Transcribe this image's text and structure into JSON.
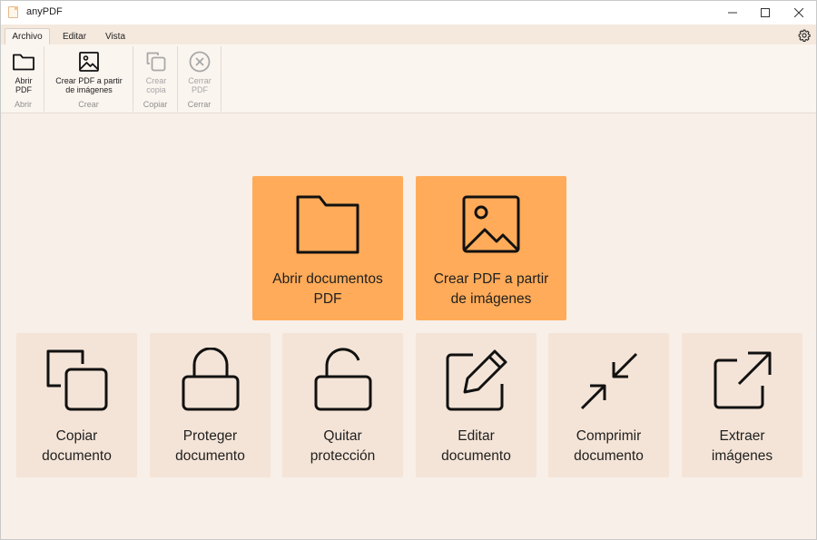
{
  "window": {
    "title": "anyPDF"
  },
  "tabs": [
    {
      "label": "Archivo",
      "active": true
    },
    {
      "label": "Editar",
      "active": false
    },
    {
      "label": "Vista",
      "active": false
    }
  ],
  "ribbon": {
    "groups": [
      {
        "label": "Abrir",
        "buttons": [
          {
            "label_line1": "Abrir",
            "label_line2": "PDF",
            "icon": "folder-icon",
            "enabled": true
          }
        ]
      },
      {
        "label": "Crear",
        "buttons": [
          {
            "label_line1": "Crear PDF a partir",
            "label_line2": "de imágenes",
            "icon": "image-icon",
            "enabled": true
          }
        ]
      },
      {
        "label": "Copiar",
        "buttons": [
          {
            "label_line1": "Crear",
            "label_line2": "copia",
            "icon": "copy-icon",
            "enabled": false
          }
        ]
      },
      {
        "label": "Cerrar",
        "buttons": [
          {
            "label_line1": "Cerrar",
            "label_line2": "PDF",
            "icon": "close-circle-icon",
            "enabled": false
          }
        ]
      }
    ]
  },
  "main": {
    "primary_actions": [
      {
        "line1": "Abrir documentos",
        "line2": "PDF",
        "icon": "folder-icon"
      },
      {
        "line1": "Crear PDF a partir",
        "line2": "de imágenes",
        "icon": "image-icon"
      }
    ],
    "secondary_actions": [
      {
        "line1": "Copiar",
        "line2": "documento",
        "icon": "copy-icon"
      },
      {
        "line1": "Proteger",
        "line2": "documento",
        "icon": "lock-icon"
      },
      {
        "line1": "Quitar",
        "line2": "protección",
        "icon": "unlock-icon"
      },
      {
        "line1": "Editar",
        "line2": "documento",
        "icon": "edit-icon"
      },
      {
        "line1": "Comprimir",
        "line2": "documento",
        "icon": "compress-icon"
      },
      {
        "line1": "Extraer",
        "line2": "imágenes",
        "icon": "external-link-icon"
      }
    ]
  },
  "colors": {
    "background": "#f7efe8",
    "primary_card": "#ffab59",
    "secondary_card": "#f4e4d7"
  }
}
